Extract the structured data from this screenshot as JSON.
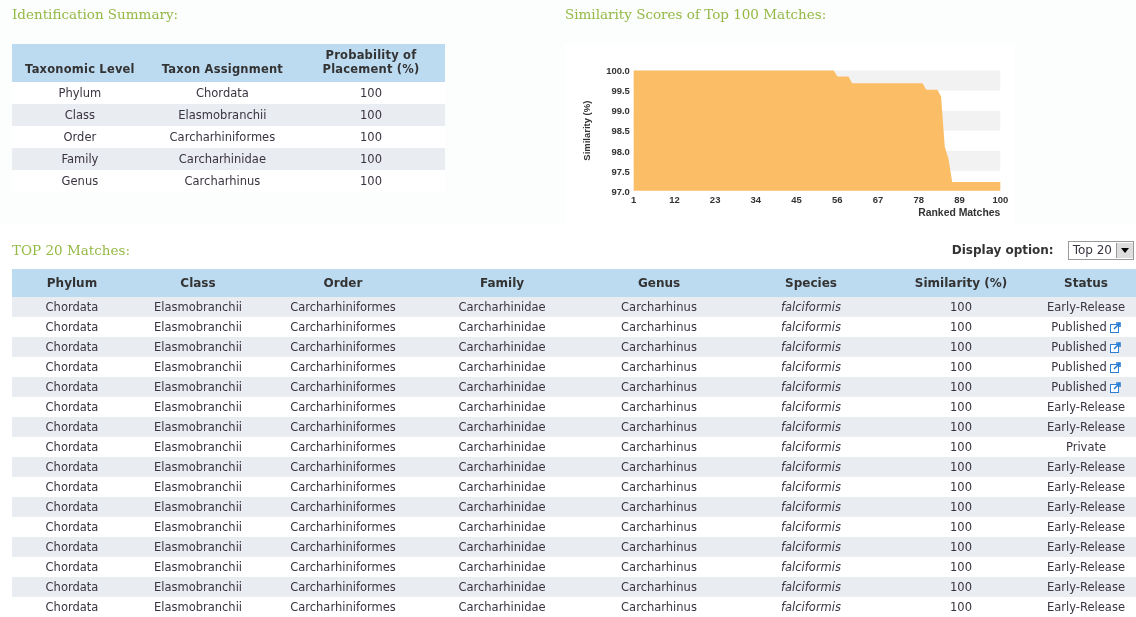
{
  "summary": {
    "title": "Identification Summary:",
    "columns": [
      "Taxonomic Level",
      "Taxon Assignment",
      "Probability of Placement (%)"
    ],
    "rows": [
      [
        "Phylum",
        "Chordata",
        "100"
      ],
      [
        "Class",
        "Elasmobranchii",
        "100"
      ],
      [
        "Order",
        "Carcharhiniformes",
        "100"
      ],
      [
        "Family",
        "Carcharhinidae",
        "100"
      ],
      [
        "Genus",
        "Carcharhinus",
        "100"
      ]
    ]
  },
  "similarity": {
    "title": "Similarity Scores of Top 100 Matches:",
    "chart_data": {
      "type": "area",
      "xlabel": "Ranked Matches",
      "ylabel": "Similarity (%)",
      "x": [
        1,
        55,
        56,
        59,
        60,
        79,
        80,
        83,
        84,
        85,
        86,
        87,
        100
      ],
      "series": [
        {
          "color": "#fbbd66",
          "values": [
            100,
            100,
            99.85,
            99.85,
            99.68,
            99.68,
            99.52,
            99.52,
            99.35,
            98.1,
            97.8,
            97.22,
            97.22
          ]
        }
      ],
      "xlim": [
        1,
        100
      ],
      "ylim": [
        97,
        100
      ],
      "xticks": [
        1,
        12,
        23,
        34,
        45,
        56,
        67,
        78,
        89,
        100
      ],
      "yticks": [
        {
          "value": 97,
          "label": "97.0"
        },
        {
          "value": 97.5,
          "label": "97.5"
        },
        {
          "value": 98,
          "label": "98.0"
        },
        {
          "value": 98.5,
          "label": "98.5"
        },
        {
          "value": 99,
          "label": "99.0"
        },
        {
          "value": 99.5,
          "label": "99.5"
        },
        {
          "value": 100,
          "label": "100.0"
        }
      ]
    }
  },
  "matches": {
    "title": "TOP 20 Matches:",
    "display_label": "Display option:",
    "display_value": "Top 20",
    "columns": [
      "Phylum",
      "Class",
      "Order",
      "Family",
      "Genus",
      "Species",
      "Similarity (%)",
      "Status"
    ],
    "rows": [
      {
        "cells": [
          "Chordata",
          "Elasmobranchii",
          "Carcharhiniformes",
          "Carcharhinidae",
          "Carcharhinus",
          "falciformis",
          "100",
          "Early-Release"
        ],
        "linked": false
      },
      {
        "cells": [
          "Chordata",
          "Elasmobranchii",
          "Carcharhiniformes",
          "Carcharhinidae",
          "Carcharhinus",
          "falciformis",
          "100",
          "Published"
        ],
        "linked": true
      },
      {
        "cells": [
          "Chordata",
          "Elasmobranchii",
          "Carcharhiniformes",
          "Carcharhinidae",
          "Carcharhinus",
          "falciformis",
          "100",
          "Published"
        ],
        "linked": true
      },
      {
        "cells": [
          "Chordata",
          "Elasmobranchii",
          "Carcharhiniformes",
          "Carcharhinidae",
          "Carcharhinus",
          "falciformis",
          "100",
          "Published"
        ],
        "linked": true
      },
      {
        "cells": [
          "Chordata",
          "Elasmobranchii",
          "Carcharhiniformes",
          "Carcharhinidae",
          "Carcharhinus",
          "falciformis",
          "100",
          "Published"
        ],
        "linked": true
      },
      {
        "cells": [
          "Chordata",
          "Elasmobranchii",
          "Carcharhiniformes",
          "Carcharhinidae",
          "Carcharhinus",
          "falciformis",
          "100",
          "Early-Release"
        ],
        "linked": false
      },
      {
        "cells": [
          "Chordata",
          "Elasmobranchii",
          "Carcharhiniformes",
          "Carcharhinidae",
          "Carcharhinus",
          "falciformis",
          "100",
          "Early-Release"
        ],
        "linked": false
      },
      {
        "cells": [
          "Chordata",
          "Elasmobranchii",
          "Carcharhiniformes",
          "Carcharhinidae",
          "Carcharhinus",
          "falciformis",
          "100",
          "Private"
        ],
        "linked": false
      },
      {
        "cells": [
          "Chordata",
          "Elasmobranchii",
          "Carcharhiniformes",
          "Carcharhinidae",
          "Carcharhinus",
          "falciformis",
          "100",
          "Early-Release"
        ],
        "linked": false
      },
      {
        "cells": [
          "Chordata",
          "Elasmobranchii",
          "Carcharhiniformes",
          "Carcharhinidae",
          "Carcharhinus",
          "falciformis",
          "100",
          "Early-Release"
        ],
        "linked": false
      },
      {
        "cells": [
          "Chordata",
          "Elasmobranchii",
          "Carcharhiniformes",
          "Carcharhinidae",
          "Carcharhinus",
          "falciformis",
          "100",
          "Early-Release"
        ],
        "linked": false
      },
      {
        "cells": [
          "Chordata",
          "Elasmobranchii",
          "Carcharhiniformes",
          "Carcharhinidae",
          "Carcharhinus",
          "falciformis",
          "100",
          "Early-Release"
        ],
        "linked": false
      },
      {
        "cells": [
          "Chordata",
          "Elasmobranchii",
          "Carcharhiniformes",
          "Carcharhinidae",
          "Carcharhinus",
          "falciformis",
          "100",
          "Early-Release"
        ],
        "linked": false
      },
      {
        "cells": [
          "Chordata",
          "Elasmobranchii",
          "Carcharhiniformes",
          "Carcharhinidae",
          "Carcharhinus",
          "falciformis",
          "100",
          "Early-Release"
        ],
        "linked": false
      },
      {
        "cells": [
          "Chordata",
          "Elasmobranchii",
          "Carcharhiniformes",
          "Carcharhinidae",
          "Carcharhinus",
          "falciformis",
          "100",
          "Early-Release"
        ],
        "linked": false
      },
      {
        "cells": [
          "Chordata",
          "Elasmobranchii",
          "Carcharhiniformes",
          "Carcharhinidae",
          "Carcharhinus",
          "falciformis",
          "100",
          "Early-Release"
        ],
        "linked": false
      }
    ]
  }
}
